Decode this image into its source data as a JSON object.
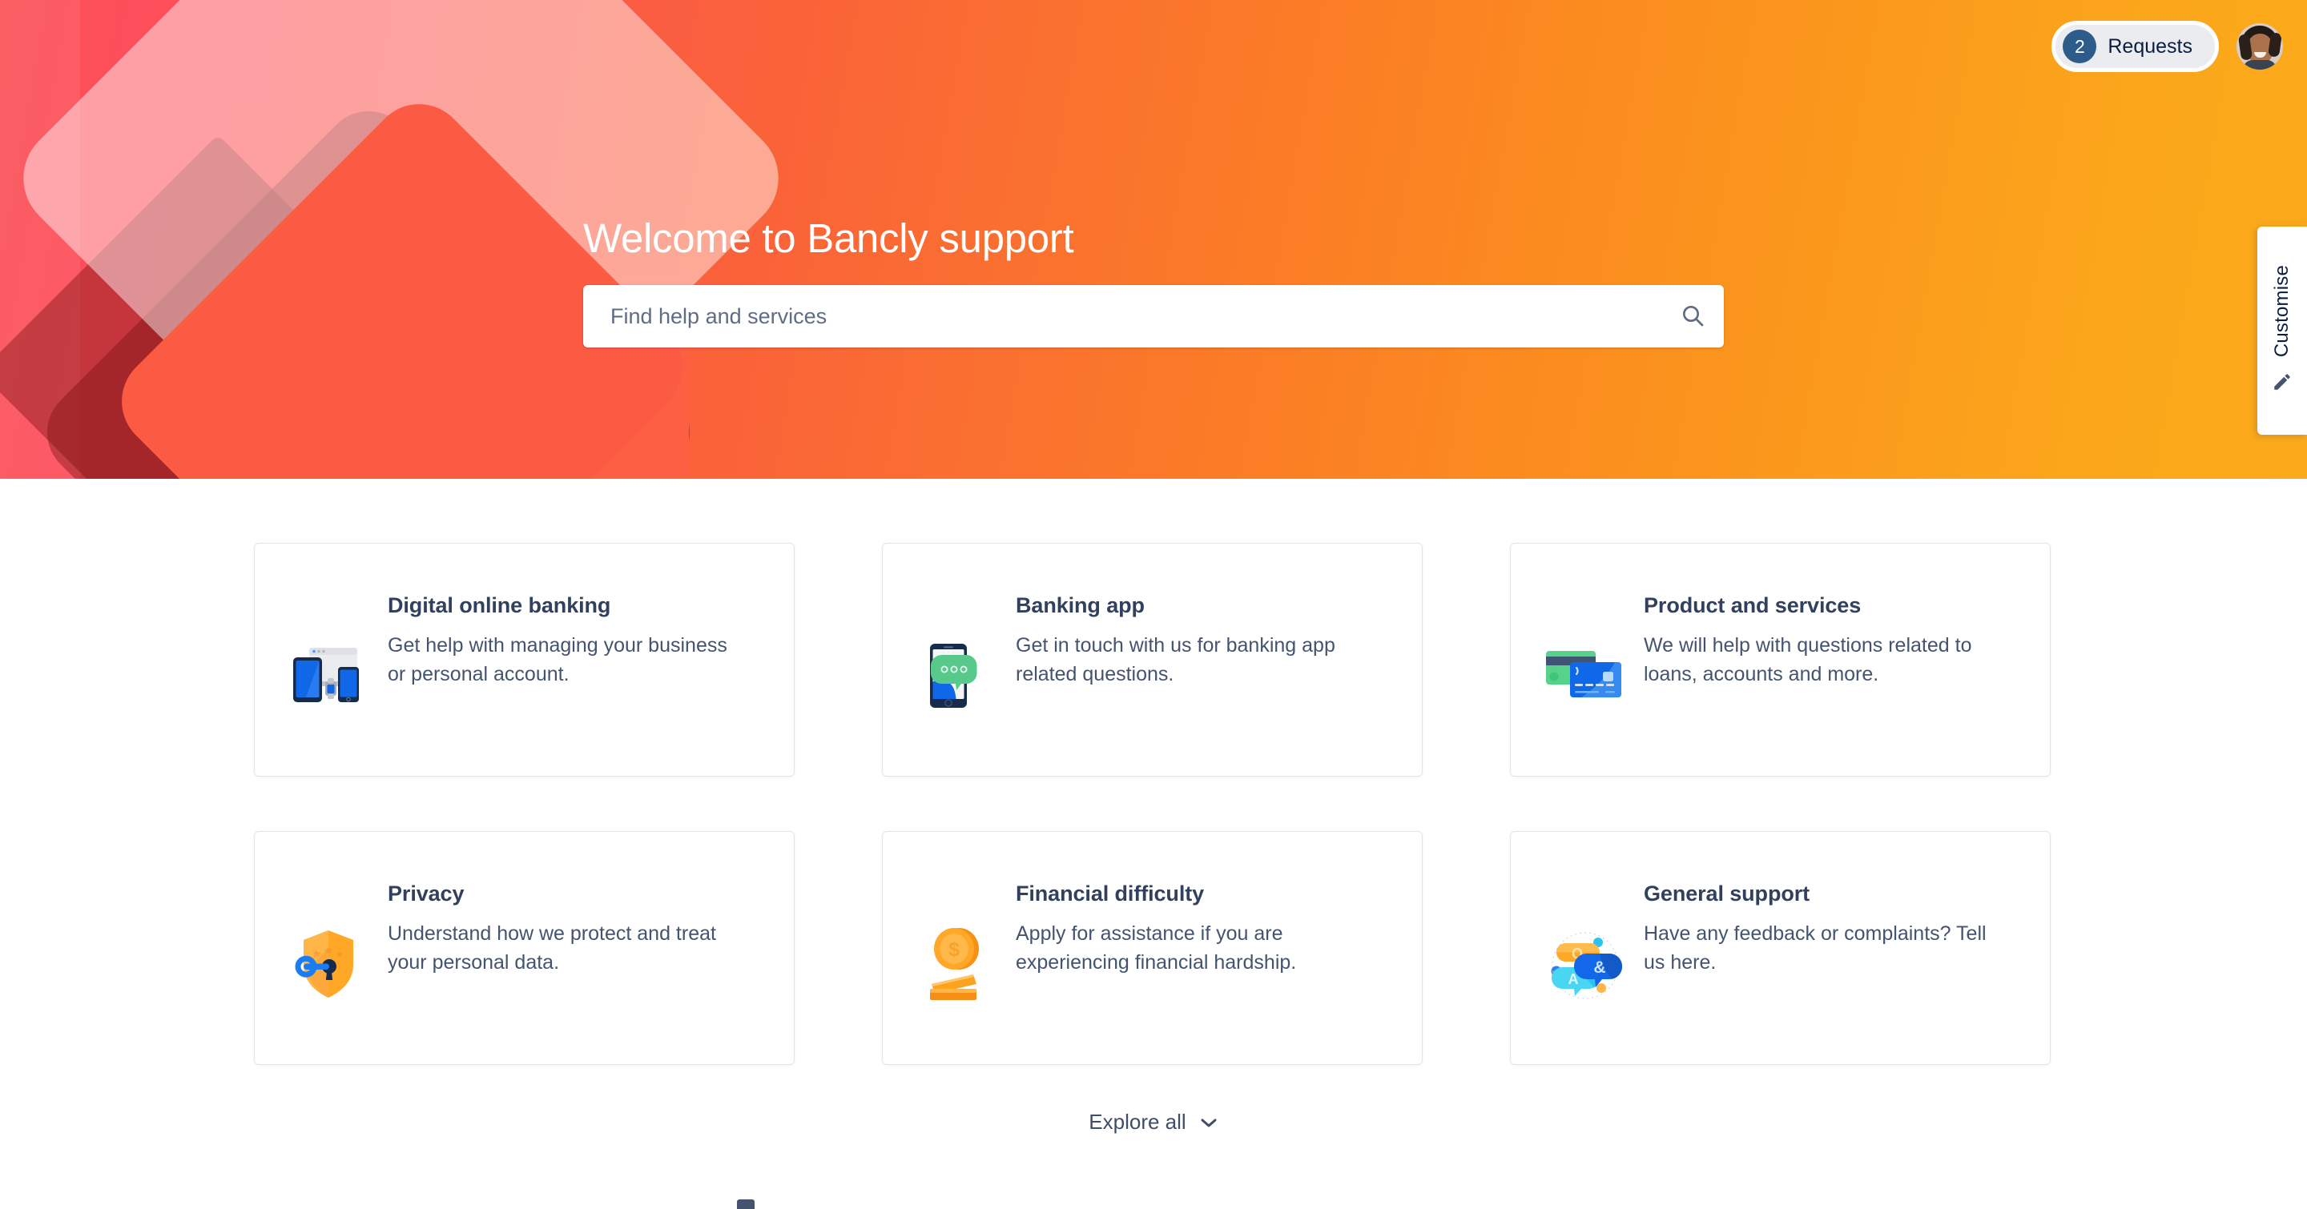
{
  "topnav": {
    "requests_count": "2",
    "requests_label": "Requests",
    "avatar_name": "user-avatar"
  },
  "customise": {
    "label": "Customise",
    "icon": "pencil-icon"
  },
  "hero": {
    "title": "Welcome to Bancly support",
    "gradient_start": "#FA5258",
    "gradient_end": "#FBAA1B"
  },
  "search": {
    "value": "",
    "placeholder": "Find help and services",
    "icon": "search-icon"
  },
  "cards": [
    {
      "title": "Digital online banking",
      "desc": "Get help with managing your business or personal account.",
      "icon": "devices-icon"
    },
    {
      "title": "Banking app",
      "desc": "Get in touch with us for banking app related questions.",
      "icon": "mobile-chat-icon"
    },
    {
      "title": "Product and services",
      "desc": "We will help with questions related to loans, accounts and more.",
      "icon": "credit-cards-icon"
    },
    {
      "title": "Privacy",
      "desc": "Understand how we protect and treat your personal data.",
      "icon": "shield-key-icon"
    },
    {
      "title": "Financial difficulty",
      "desc": "Apply for assistance if you are experiencing financial hardship.",
      "icon": "coin-stack-icon"
    },
    {
      "title": "General support",
      "desc": "Have any feedback or complaints? Tell us here.",
      "icon": "qa-bubbles-icon"
    }
  ],
  "explore": {
    "label": "Explore all",
    "icon": "chevron-down-icon"
  }
}
